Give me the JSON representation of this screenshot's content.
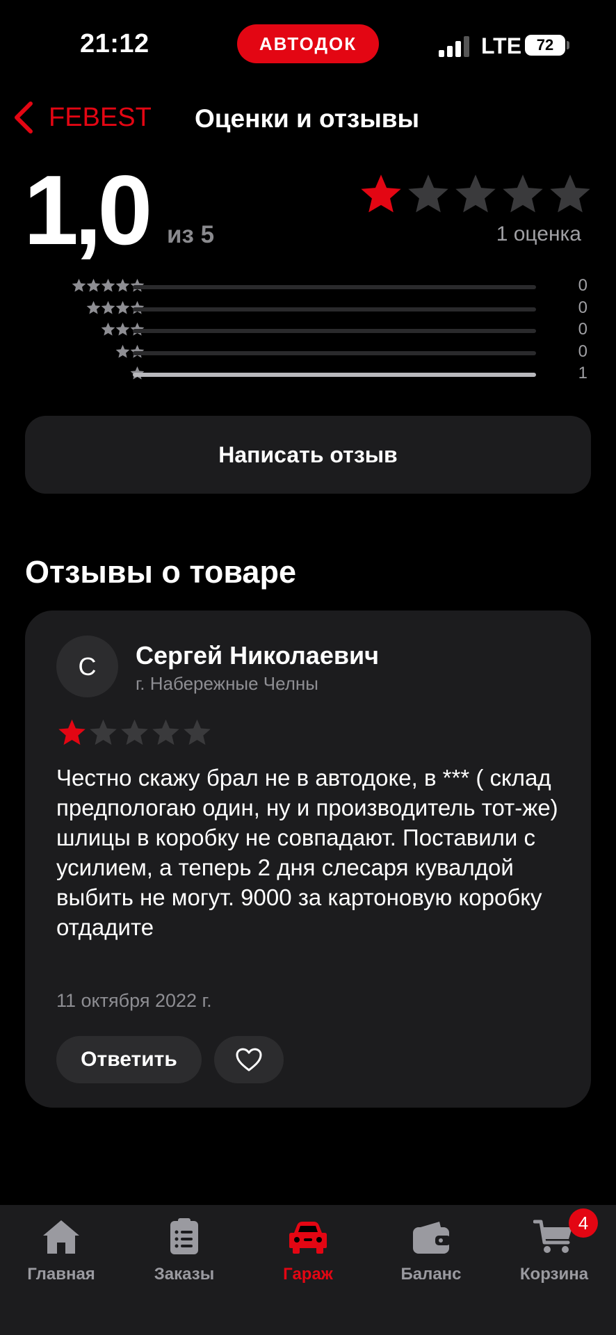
{
  "status_bar": {
    "time": "21:12",
    "brand": "АВТОДОК",
    "network": "LTE",
    "battery": "72"
  },
  "header": {
    "back_label": "FEBEST",
    "title": "Оценки и отзывы"
  },
  "summary": {
    "rating": "1,0",
    "out_of": "из 5",
    "stars_filled": 1,
    "count_label": "1 оценка",
    "histogram": [
      {
        "stars": 5,
        "count": "0",
        "fraction": 0
      },
      {
        "stars": 4,
        "count": "0",
        "fraction": 0
      },
      {
        "stars": 3,
        "count": "0",
        "fraction": 0
      },
      {
        "stars": 2,
        "count": "0",
        "fraction": 0
      },
      {
        "stars": 1,
        "count": "1",
        "fraction": 1
      }
    ]
  },
  "write_review_label": "Написать отзыв",
  "reviews_section_title": "Отзывы о товаре",
  "review": {
    "avatar_letter": "С",
    "author": "Сергей Николаевич",
    "city": "г. Набережные Челны",
    "stars_filled": 1,
    "text": "Честно скажу брал не в автодоке, в *** ( склад предпологаю один, ну и производитель тот-же) шлицы в коробку не совпадают. Поставили с усилием, а теперь 2 дня слесаря кувалдой выбить не могут. 9000 за картоновую коробку отдадите",
    "date": "11 октября 2022 г.",
    "reply_label": "Ответить"
  },
  "tabs": [
    {
      "label": "Главная",
      "icon": "home-icon"
    },
    {
      "label": "Заказы",
      "icon": "orders-icon"
    },
    {
      "label": "Гараж",
      "icon": "car-icon",
      "active": true
    },
    {
      "label": "Баланс",
      "icon": "wallet-icon"
    },
    {
      "label": "Корзина",
      "icon": "cart-icon"
    }
  ],
  "cart_badge": "4",
  "colors": {
    "accent": "#e30613",
    "card": "#1c1c1e",
    "star_empty": "#3a3a3c",
    "muted": "#8e8e93"
  }
}
